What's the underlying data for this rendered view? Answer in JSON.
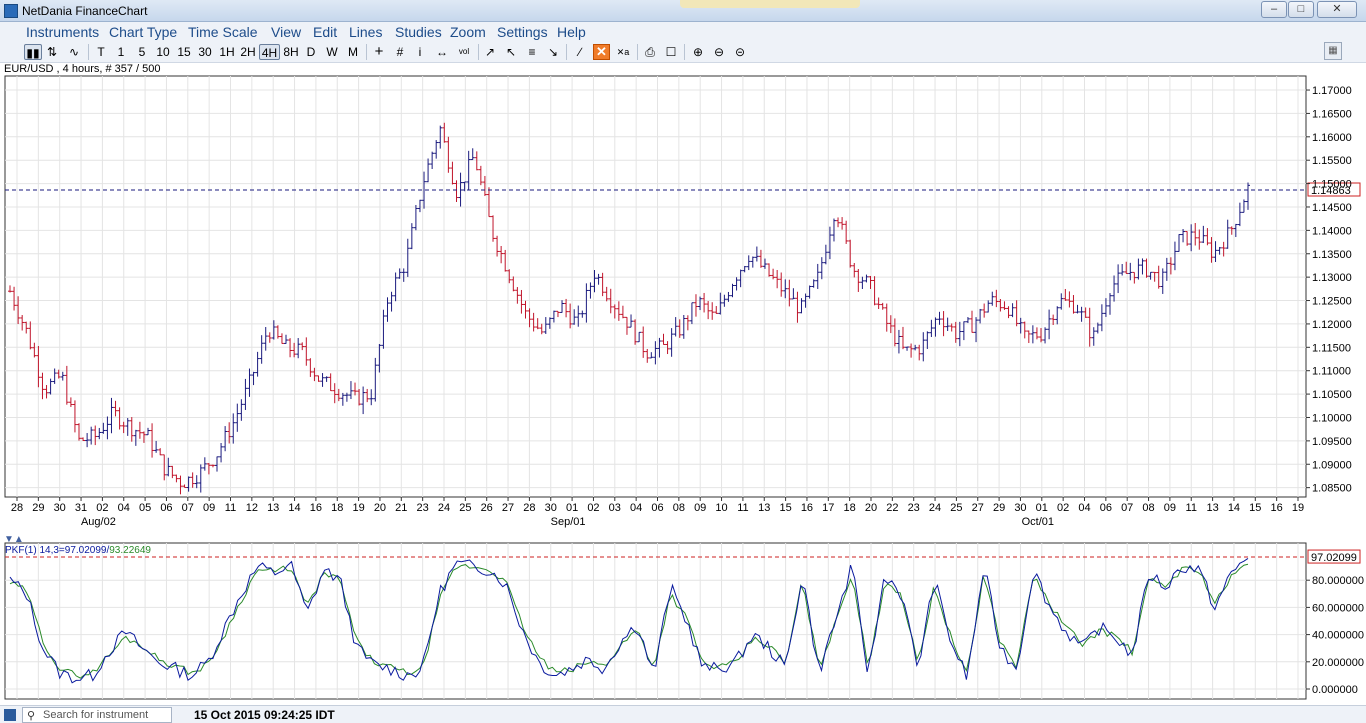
{
  "window": {
    "title": "NetDania FinanceChart"
  },
  "menu": [
    "Instruments",
    "Chart Type",
    "Time Scale",
    "View",
    "Edit",
    "Lines",
    "Studies",
    "Zoom",
    "Settings",
    "Help"
  ],
  "toolbar": {
    "timescales": [
      "T",
      "1",
      "5",
      "10",
      "15",
      "30",
      "1H",
      "2H",
      "4H",
      "8H",
      "D",
      "W",
      "M"
    ],
    "selected": "4H"
  },
  "chart_info": "EUR/USD , 4 hours, # 357 / 500",
  "status": {
    "search_placeholder": "Search for instrument",
    "datetime": "15 Oct 2015 09:24:25 IDT"
  },
  "colors": {
    "up": "#1a1a7e",
    "down": "#c0142a",
    "stoch_k": "#0a1a9e",
    "stoch_d": "#2a8a2a",
    "hline": "#1a1a7e",
    "hline2": "#cc2222",
    "accent": "#f07c2a"
  },
  "chart_data": [
    {
      "type": "ohlc",
      "ylim": [
        1.083,
        1.173
      ],
      "yticks": [
        "1.17000",
        "1.16500",
        "1.16000",
        "1.15500",
        "1.15000",
        "1.14500",
        "1.14000",
        "1.13500",
        "1.13000",
        "1.12500",
        "1.12000",
        "1.11500",
        "1.11000",
        "1.10500",
        "1.10000",
        "1.09500",
        "1.09000",
        "1.08500"
      ],
      "last_price": "1.14863",
      "x_labels": [
        "28",
        "29",
        "30",
        "31",
        "02",
        "04",
        "05",
        "06",
        "07",
        "09",
        "11",
        "12",
        "13",
        "14",
        "16",
        "18",
        "19",
        "20",
        "21",
        "23",
        "24",
        "25",
        "26",
        "27",
        "28",
        "30",
        "01",
        "02",
        "03",
        "04",
        "06",
        "08",
        "09",
        "10",
        "11",
        "13",
        "15",
        "16",
        "17",
        "18",
        "20",
        "22",
        "23",
        "24",
        "25",
        "27",
        "29",
        "30",
        "01",
        "02",
        "04",
        "06",
        "07",
        "08",
        "09",
        "11",
        "13",
        "14",
        "15",
        "16",
        "19"
      ],
      "month_labels": [
        "Aug/02",
        "Sep/01",
        "Oct/01"
      ],
      "series": [
        {
          "name": "close",
          "values": [
            1.127,
            1.118,
            1.106,
            1.109,
            1.095,
            1.096,
            1.101,
            1.098,
            1.096,
            1.089,
            1.086,
            1.088,
            1.092,
            1.099,
            1.108,
            1.119,
            1.115,
            1.114,
            1.108,
            1.106,
            1.104,
            1.105,
            1.126,
            1.133,
            1.15,
            1.162,
            1.148,
            1.156,
            1.14,
            1.131,
            1.122,
            1.118,
            1.124,
            1.12,
            1.131,
            1.125,
            1.12,
            1.114,
            1.115,
            1.119,
            1.125,
            1.121,
            1.129,
            1.135,
            1.131,
            1.127,
            1.123,
            1.13,
            1.145,
            1.132,
            1.128,
            1.12,
            1.114,
            1.115,
            1.122,
            1.118,
            1.12,
            1.125,
            1.124,
            1.117,
            1.118,
            1.125,
            1.124,
            1.117,
            1.128,
            1.131,
            1.132,
            1.129,
            1.138,
            1.139,
            1.135,
            1.14,
            1.149
          ]
        }
      ]
    },
    {
      "type": "line",
      "label": "PKF(1) 14,3=97.02099/93.22649",
      "label_k": "PKF(1) 14,3=97.02099/",
      "label_d": "93.22649",
      "ylim": [
        0,
        100
      ],
      "yticks": [
        "80.000000",
        "60.000000",
        "40.000000",
        "20.000000",
        "0.000000"
      ],
      "last_value": "97.02099",
      "series": [
        {
          "name": "K",
          "values": [
            80,
            70,
            30,
            12,
            8,
            10,
            28,
            42,
            30,
            20,
            15,
            10,
            20,
            45,
            70,
            90,
            85,
            92,
            55,
            88,
            80,
            30,
            18,
            15,
            10,
            15,
            70,
            92,
            90,
            88,
            78,
            45,
            20,
            10,
            15,
            22,
            15,
            35,
            48,
            10,
            75,
            50,
            15,
            15,
            20,
            40,
            30,
            15,
            85,
            12,
            50,
            90,
            10,
            85,
            70,
            15,
            80,
            35,
            8,
            90,
            30,
            15,
            88,
            60,
            42,
            30,
            45,
            38,
            25,
            85,
            75,
            90,
            88,
            60,
            85,
            97
          ]
        },
        {
          "name": "D",
          "values": [
            78,
            72,
            35,
            15,
            10,
            12,
            25,
            38,
            32,
            22,
            17,
            12,
            18,
            40,
            65,
            88,
            86,
            90,
            60,
            85,
            80,
            35,
            20,
            16,
            12,
            14,
            65,
            90,
            90,
            88,
            80,
            48,
            24,
            12,
            14,
            20,
            17,
            32,
            44,
            15,
            70,
            52,
            18,
            16,
            19,
            37,
            32,
            18,
            80,
            15,
            48,
            86,
            14,
            80,
            70,
            18,
            76,
            38,
            10,
            86,
            34,
            17,
            84,
            62,
            45,
            33,
            43,
            39,
            27,
            80,
            76,
            88,
            88,
            63,
            82,
            93
          ]
        }
      ]
    }
  ]
}
